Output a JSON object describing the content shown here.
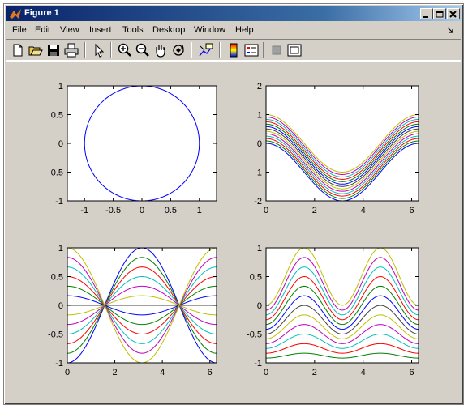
{
  "window": {
    "title": "Figure 1"
  },
  "menu": [
    "File",
    "Edit",
    "View",
    "Insert",
    "Tools",
    "Desktop",
    "Window",
    "Help"
  ],
  "toolbar": [
    "new-figure",
    "open-file",
    "save",
    "print",
    "edit-plot",
    "zoom-in",
    "zoom-out",
    "pan",
    "rotate-3d",
    "data-cursor",
    "insert-colorbar",
    "insert-legend",
    "hide-plot-tools",
    "show-plot-tools"
  ],
  "colors": {
    "titlebar_start": "#0a246a",
    "titlebar_end": "#a6caf0",
    "window_bg": "#d4d0c8"
  },
  "chart_data": [
    {
      "type": "line",
      "subplot": "top-left",
      "series": [
        {
          "description": "circle x=cos(t), y=sin(t)",
          "color": "#0000ff"
        }
      ],
      "xlim": [
        -1.3,
        1.3
      ],
      "ylim": [
        -1,
        1
      ],
      "xticks": [
        "-1",
        "-0.5",
        "0",
        "0.5",
        "1"
      ],
      "yticks": [
        "-1",
        "-0.5",
        "0",
        "0.5",
        "1"
      ]
    },
    {
      "type": "line",
      "subplot": "top-right",
      "expression": "cos(x) + k/12 - 1, k = 1..12 (ascending offsets)",
      "xlim": [
        0,
        6.283
      ],
      "ylim": [
        -2,
        2
      ],
      "xticks": [
        "0",
        "2",
        "4",
        "6"
      ],
      "yticks": [
        "-2",
        "-1",
        "0",
        "1",
        "2"
      ]
    },
    {
      "type": "line",
      "subplot": "bottom-left",
      "expression": "a*cos(x), a from -1 to 1",
      "xlim": [
        0,
        6.283
      ],
      "ylim": [
        -1,
        1
      ],
      "xticks": [
        "0",
        "2",
        "4",
        "6"
      ],
      "yticks": [
        "-1",
        "-0.5",
        "0",
        "0.5",
        "1"
      ]
    },
    {
      "type": "line",
      "subplot": "bottom-right",
      "expression": "a*sin(x)^2 - (1-a), a from 0 to 1",
      "xlim": [
        0,
        6.283
      ],
      "ylim": [
        -1,
        1
      ],
      "xticks": [
        "0",
        "2",
        "4",
        "6"
      ],
      "yticks": [
        "-1",
        "-0.5",
        "0",
        "0.5",
        "1"
      ]
    }
  ]
}
